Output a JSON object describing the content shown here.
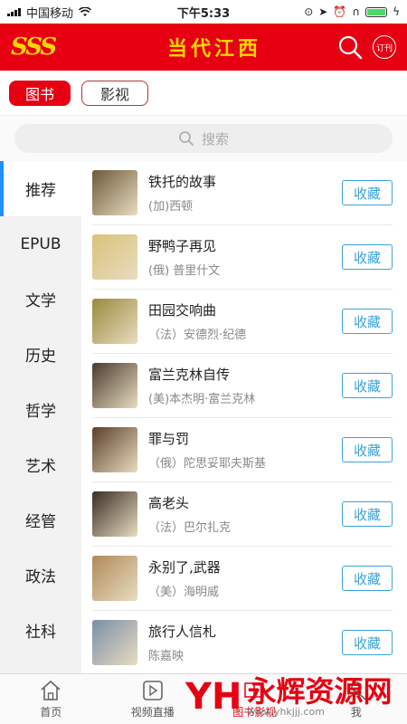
{
  "status": {
    "carrier": "中国移动",
    "time": "下午5:33"
  },
  "header": {
    "logo": "SSS",
    "brand": "当代江西",
    "subscribe_label": "订刊"
  },
  "tabs": [
    {
      "label": "图书",
      "active": true
    },
    {
      "label": "影视",
      "active": false
    }
  ],
  "search": {
    "placeholder": "搜索"
  },
  "sidebar": {
    "items": [
      {
        "label": "推荐",
        "active": true
      },
      {
        "label": "EPUB"
      },
      {
        "label": "文学"
      },
      {
        "label": "历史"
      },
      {
        "label": "哲学"
      },
      {
        "label": "艺术"
      },
      {
        "label": "经管"
      },
      {
        "label": "政法"
      },
      {
        "label": "社科"
      }
    ]
  },
  "books": [
    {
      "title": "铁托的故事",
      "author": "(加)西顿",
      "cover": "#6b5a3a",
      "action": "收藏"
    },
    {
      "title": "野鸭子再见",
      "author": "(俄) 普里什文",
      "cover": "#d9c27a",
      "action": "收藏"
    },
    {
      "title": "田园交响曲",
      "author": "（法）安德烈·纪德",
      "cover": "#9a8a3c",
      "action": "收藏"
    },
    {
      "title": "富兰克林自传",
      "author": "(美)本杰明·富兰克林",
      "cover": "#4a3b2e",
      "action": "收藏"
    },
    {
      "title": "罪与罚",
      "author": "（俄）陀思妥耶夫斯基",
      "cover": "#5c3f2a",
      "action": "收藏"
    },
    {
      "title": "高老头",
      "author": "（法）巴尔扎克",
      "cover": "#3a2d25",
      "action": "收藏"
    },
    {
      "title": "永别了,武器",
      "author": "（美）海明威",
      "cover": "#b08a5a",
      "action": "收藏"
    },
    {
      "title": "旅行人信札",
      "author": "陈嘉映",
      "cover": "#7a8fa8",
      "action": "收藏"
    }
  ],
  "bottom_nav": [
    {
      "label": "首页",
      "icon": "home-icon"
    },
    {
      "label": "视频直播",
      "icon": "video-icon"
    },
    {
      "label": "图书影视",
      "icon": "book-icon",
      "active": true
    },
    {
      "label": "我",
      "icon": "user-icon"
    }
  ],
  "watermark": {
    "mark": "YH",
    "text": "永辉资源网",
    "url": "www.yhkjjj.com"
  }
}
